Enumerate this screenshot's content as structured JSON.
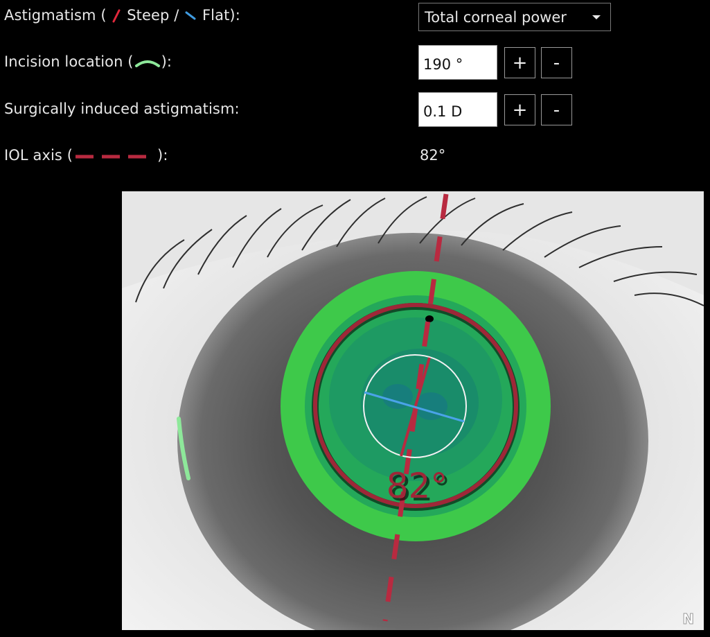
{
  "astigmatism": {
    "prefix": "Astigmatism (",
    "steep": "Steep /",
    "flat": "Flat):",
    "steep_color": "#e0283c",
    "flat_color": "#3f9be0",
    "selected_option": "Total corneal power"
  },
  "incision": {
    "label": "Incision location (",
    "suffix": "):",
    "value": "190 °",
    "icon_color": "#8ee89a",
    "plus": "+",
    "minus": "-"
  },
  "sia": {
    "label": "Surgically induced astigmatism:",
    "value": "0.1 D",
    "plus": "+",
    "minus": "-"
  },
  "iol": {
    "label": "IOL axis (",
    "suffix": "):",
    "value": "82°",
    "color": "#b82a40"
  },
  "viewer": {
    "axis_label": "82°",
    "watermark": "N"
  }
}
